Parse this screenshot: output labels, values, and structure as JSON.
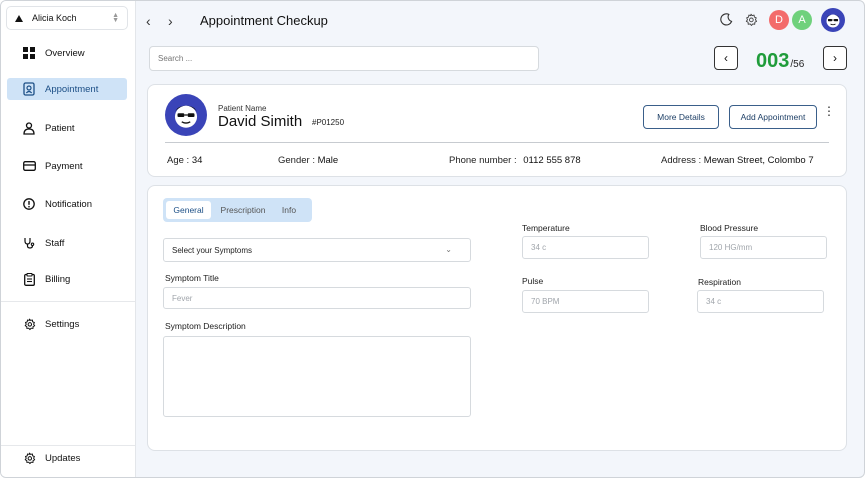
{
  "user": {
    "name": "Alicia Koch"
  },
  "sidebar": {
    "items": [
      {
        "label": "Overview"
      },
      {
        "label": "Appointment"
      },
      {
        "label": "Patient"
      },
      {
        "label": "Payment"
      },
      {
        "label": "Notification"
      },
      {
        "label": "Staff"
      },
      {
        "label": "Billing"
      },
      {
        "label": "Settings"
      }
    ],
    "footer": {
      "label": "Updates"
    }
  },
  "header": {
    "title": "Appointment Checkup",
    "avatars": [
      {
        "letter": "D",
        "color": "#f36b6b"
      },
      {
        "letter": "A",
        "color": "#6fd17c"
      }
    ]
  },
  "search": {
    "placeholder": "Search ..."
  },
  "pager": {
    "current": "003",
    "total": "/56"
  },
  "patient": {
    "name_label": "Patient Name",
    "name": "David Simith",
    "id": "#P01250",
    "more_details": "More Details",
    "add_appointment": "Add Appointment",
    "age_label": "Age :",
    "age": "34",
    "gender_label": "Gender :",
    "gender": "Male",
    "phone_label": "Phone number :",
    "phone": "0112 555 878",
    "address_label": "Address :",
    "address": "Mewan Street, Colombo 7"
  },
  "tabs": [
    {
      "label": "General"
    },
    {
      "label": "Prescription"
    },
    {
      "label": "Info"
    }
  ],
  "form": {
    "symptoms_select": "Select your Symptoms",
    "symptom_title_label": "Symptom Title",
    "symptom_title_placeholder": "Fever",
    "symptom_desc_label": "Symptom Description",
    "temperature_label": "Temperature",
    "temperature_placeholder": "34 c",
    "bp_label": "Blood Pressure",
    "bp_placeholder": "120 HG/mm",
    "pulse_label": "Pulse",
    "pulse_placeholder": "70 BPM",
    "respiration_label": "Respiration",
    "respiration_placeholder": "34 c"
  }
}
